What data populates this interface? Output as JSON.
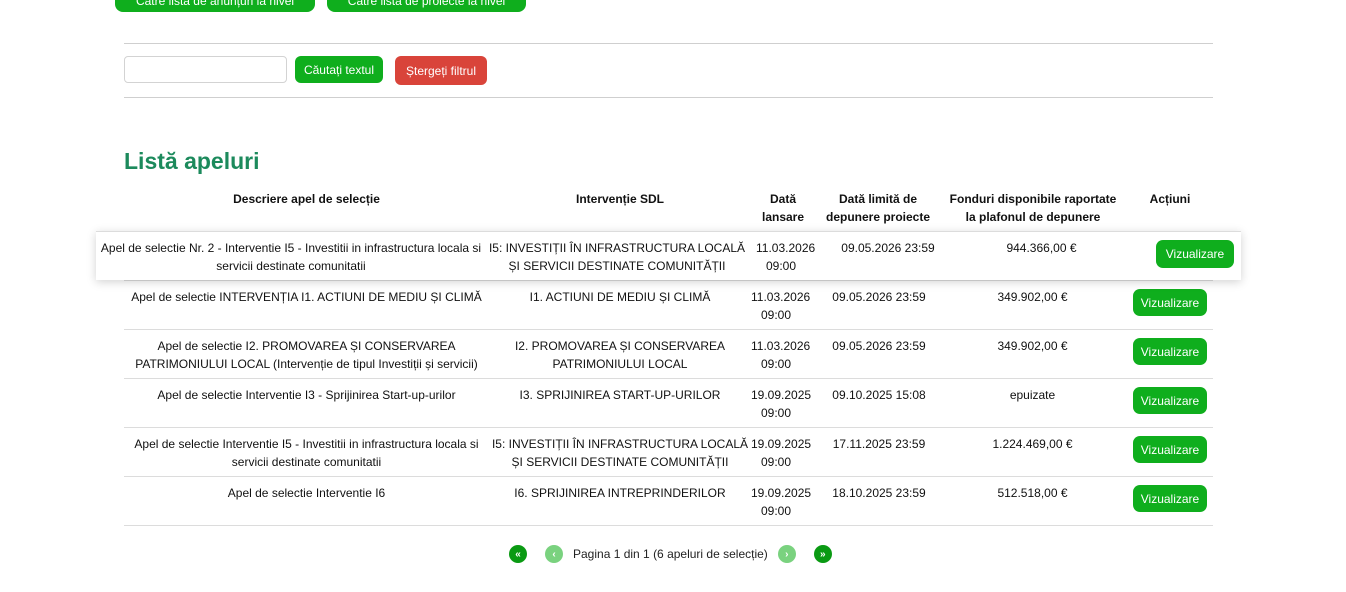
{
  "top_buttons": {
    "announcements": "Către lista de anunțuri la nivel GAL",
    "projects": "Către lista de proiecte la nivel GAL"
  },
  "search": {
    "value": "",
    "placeholder": "",
    "search_label": "Căutați textul",
    "clear_label": "Ștergeți filtrul"
  },
  "title": "Listă apeluri",
  "table": {
    "headers": {
      "desc": "Descriere apel de selecție",
      "int": "Intervenție SDL",
      "date": "Dată lansare",
      "lim": "Dată limită de depunere proiecte",
      "fund": "Fonduri disponibile raportate la plafonul de depunere",
      "actions": "Acțiuni"
    },
    "rows": [
      {
        "desc": "Apel de selectie Nr. 2 - Interventie I5 - Investitii in infrastructura locala si servicii destinate comunitatii",
        "int": "I5: INVESTIȚII ÎN INFRASTRUCTURA LOCALĂ ȘI SERVICII DESTINATE COMUNITĂȚII",
        "date": "11.03.2026 09:00",
        "lim": "09.05.2026 23:59",
        "fund": "944.366,00 €",
        "action": "Vizualizare"
      },
      {
        "desc": "Apel de selectie INTERVENȚIA I1. ACTIUNI DE MEDIU ȘI CLIMĂ",
        "int": "I1. ACTIUNI DE MEDIU ȘI CLIMĂ",
        "date": "11.03.2026 09:00",
        "lim": "09.05.2026 23:59",
        "fund": "349.902,00 €",
        "action": "Vizualizare"
      },
      {
        "desc": "Apel de selectie I2. PROMOVAREA ȘI CONSERVAREA PATRIMONIULUI LOCAL (Intervenție de tipul Investiții și servicii)",
        "int": "I2. PROMOVAREA ȘI CONSERVAREA PATRIMONIULUI LOCAL",
        "date": "11.03.2026 09:00",
        "lim": "09.05.2026 23:59",
        "fund": "349.902,00 €",
        "action": "Vizualizare"
      },
      {
        "desc": "Apel de selectie Interventie I3 - Sprijinirea Start-up-urilor",
        "int": "I3. SPRIJINIREA START-UP-URILOR",
        "date": "19.09.2025 09:00",
        "lim": "09.10.2025 15:08",
        "fund": "epuizate",
        "action": "Vizualizare"
      },
      {
        "desc": "Apel de selectie Interventie I5 - Investitii in infrastructura locala si servicii destinate comunitatii",
        "int": "I5: INVESTIȚII ÎN INFRASTRUCTURA LOCALĂ ȘI SERVICII DESTINATE COMUNITĂȚII",
        "date": "19.09.2025 09:00",
        "lim": "17.11.2025 23:59",
        "fund": "1.224.469,00 €",
        "action": "Vizualizare"
      },
      {
        "desc": "Apel de selectie Interventie I6",
        "int": "I6. SPRIJINIREA INTREPRINDERILOR",
        "date": "19.09.2025 09:00",
        "lim": "18.10.2025 23:59",
        "fund": "512.518,00 €",
        "action": "Vizualizare"
      }
    ]
  },
  "pager": {
    "first": "«",
    "prev": "‹",
    "text": "Pagina 1 din 1 (6 apeluri de selecție)",
    "next": "›",
    "last": "»"
  },
  "colors": {
    "accent": "#0fae1d",
    "danger": "#d9443a",
    "title": "#1c8a5c"
  }
}
